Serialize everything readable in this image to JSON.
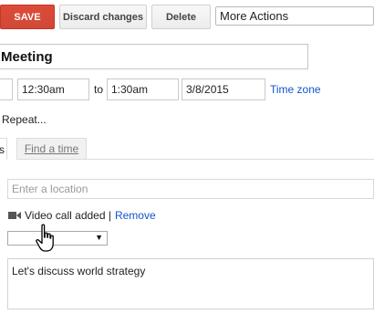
{
  "toolbar": {
    "save_label": "SAVE",
    "discard_label": "Discard changes",
    "delete_label": "Delete",
    "more_actions_label": "More Actions"
  },
  "event": {
    "title": "Meeting",
    "start_time": "12:30am",
    "to_label": "to",
    "end_time": "1:30am",
    "end_date": "3/8/2015",
    "timezone_label": "Time zone",
    "repeat_label": "Repeat..."
  },
  "tabs": {
    "edge_label": "s",
    "find_time_label": "Find a time"
  },
  "location": {
    "placeholder": "Enter a location"
  },
  "video": {
    "status": "Video call added |",
    "remove_label": "Remove",
    "icon": "video-camera-icon"
  },
  "conference_select": {
    "selected": ""
  },
  "description": {
    "text": "Let's discuss world strategy"
  },
  "colors": {
    "save_bg": "#d14836",
    "link": "#1155cc"
  }
}
